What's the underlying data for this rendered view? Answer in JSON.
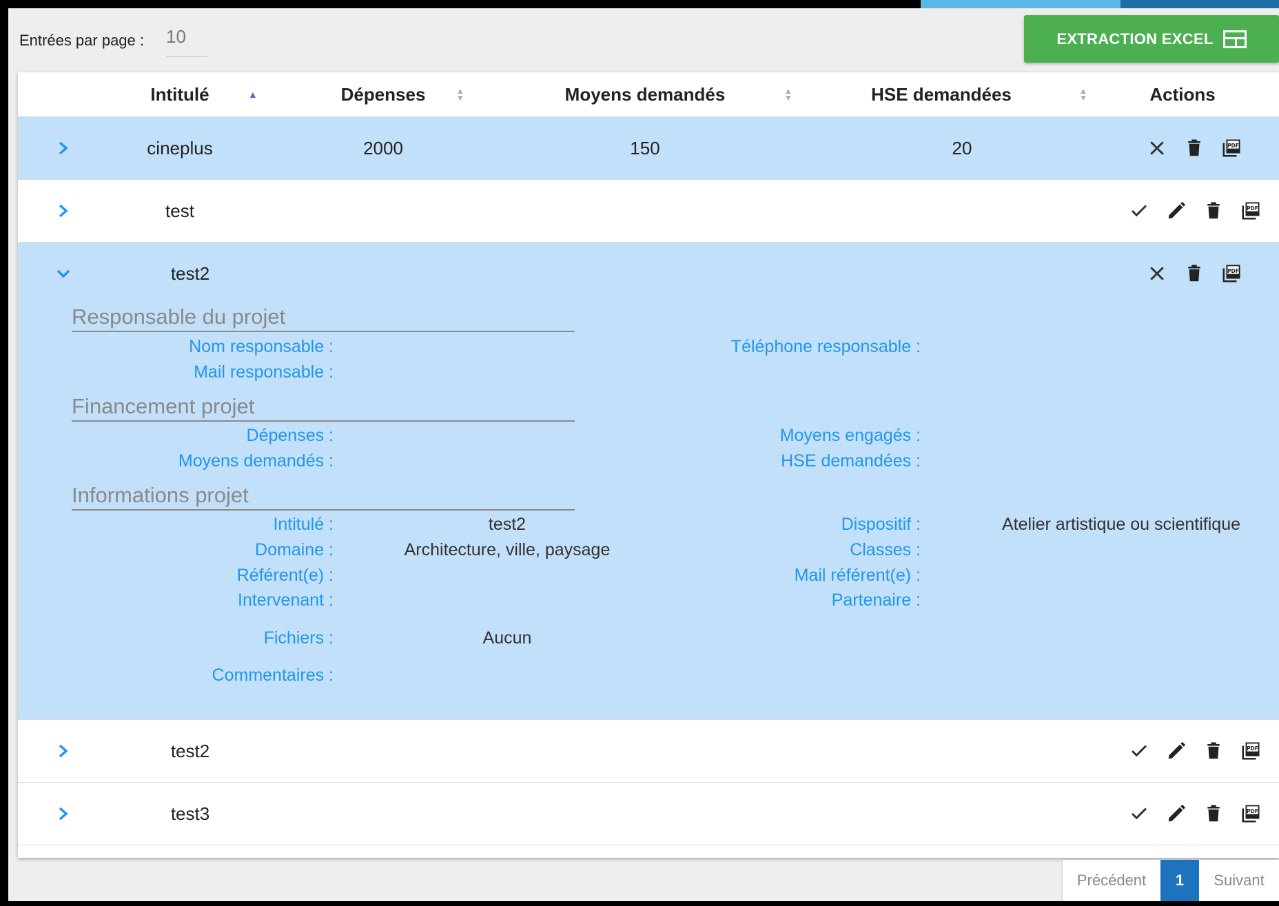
{
  "toolbar": {
    "entries_label": "Entrées par page :",
    "entries_value": "10",
    "excel_label": "EXTRACTION EXCEL"
  },
  "table": {
    "columns": [
      "Intitulé",
      "Dépenses",
      "Moyens demandés",
      "HSE demandées",
      "Actions"
    ],
    "sorted_column": "Intitulé",
    "sort_direction": "asc",
    "rows": [
      {
        "intitule": "cineplus",
        "depenses": "2000",
        "moyens": "150",
        "hse": "20",
        "selected": true,
        "expanded": false,
        "actions": [
          "close-icon",
          "trash-icon",
          "pdf-icon"
        ]
      },
      {
        "intitule": "test",
        "depenses": "",
        "moyens": "",
        "hse": "",
        "selected": false,
        "expanded": false,
        "actions": [
          "check-icon",
          "pencil-icon",
          "trash-icon",
          "pdf-icon"
        ]
      },
      {
        "intitule": "test2",
        "depenses": "",
        "moyens": "",
        "hse": "",
        "selected": true,
        "expanded": true,
        "actions": [
          "close-icon",
          "trash-icon",
          "pdf-icon"
        ]
      },
      {
        "intitule": "test2",
        "depenses": "",
        "moyens": "",
        "hse": "",
        "selected": false,
        "expanded": false,
        "actions": [
          "check-icon",
          "pencil-icon",
          "trash-icon",
          "pdf-icon"
        ]
      },
      {
        "intitule": "test3",
        "depenses": "",
        "moyens": "",
        "hse": "",
        "selected": false,
        "expanded": false,
        "actions": [
          "check-icon",
          "pencil-icon",
          "trash-icon",
          "pdf-icon"
        ]
      }
    ]
  },
  "details": {
    "responsable": {
      "title": "Responsable du projet",
      "nom_label": "Nom responsable :",
      "tel_label": "Téléphone responsable :",
      "mail_label": "Mail responsable :"
    },
    "financement": {
      "title": "Financement projet",
      "depenses_label": "Dépenses :",
      "moyens_engages_label": "Moyens engagés :",
      "moyens_demandes_label": "Moyens demandés :",
      "hse_label": "HSE demandées :"
    },
    "informations": {
      "title": "Informations projet",
      "intitule_label": "Intitulé :",
      "intitule_value": "test2",
      "dispositif_label": "Dispositif :",
      "dispositif_value": "Atelier artistique ou scientifique",
      "domaine_label": "Domaine :",
      "domaine_value": "Architecture, ville, paysage",
      "classes_label": "Classes :",
      "referent_label": "Référent(e) :",
      "mail_referent_label": "Mail référent(e) :",
      "intervenant_label": "Intervenant :",
      "partenaire_label": "Partenaire :",
      "fichiers_label": "Fichiers :",
      "fichiers_value": "Aucun",
      "commentaires_label": "Commentaires :"
    }
  },
  "pagination": {
    "prev_label": "Précédent",
    "current_page": "1",
    "next_label": "Suivant"
  },
  "colors": {
    "selected_row": "#c3e0fa",
    "label_blue": "#2196f3",
    "excel_green": "#4caf50",
    "page_active": "#1e73be"
  }
}
